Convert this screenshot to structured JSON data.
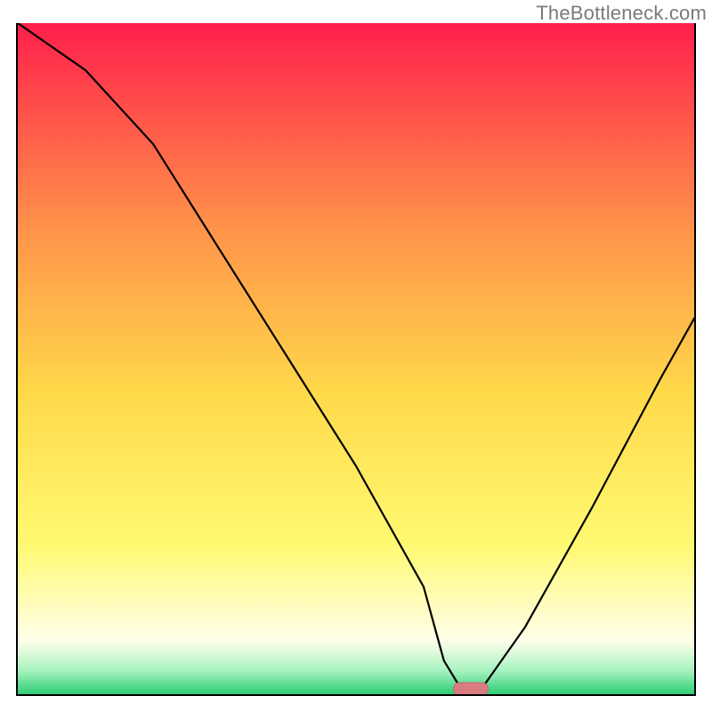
{
  "watermark": "TheBottleneck.com",
  "colors": {
    "top": "#FF1F4B",
    "mid_upper": "#FF914A",
    "mid": "#FFD94A",
    "mid_lower": "#FFFA73",
    "pale_yellow": "#FFFEEB",
    "mint": "#A7F3C0",
    "green": "#2ECC71",
    "marker_fill": "#D87C80",
    "marker_stroke": "#C46A6E"
  },
  "chart_data": {
    "type": "line",
    "title": "",
    "xlabel": "",
    "ylabel": "",
    "xlim": [
      0,
      100
    ],
    "ylim": [
      0,
      100
    ],
    "x": [
      0,
      10,
      20,
      30,
      40,
      50,
      60,
      63,
      66,
      68,
      75,
      85,
      95,
      100
    ],
    "values": [
      100,
      93,
      82,
      66,
      50,
      34,
      16,
      5,
      0,
      0,
      10,
      28,
      47,
      56
    ],
    "optimum_x": 67,
    "annotations": []
  }
}
